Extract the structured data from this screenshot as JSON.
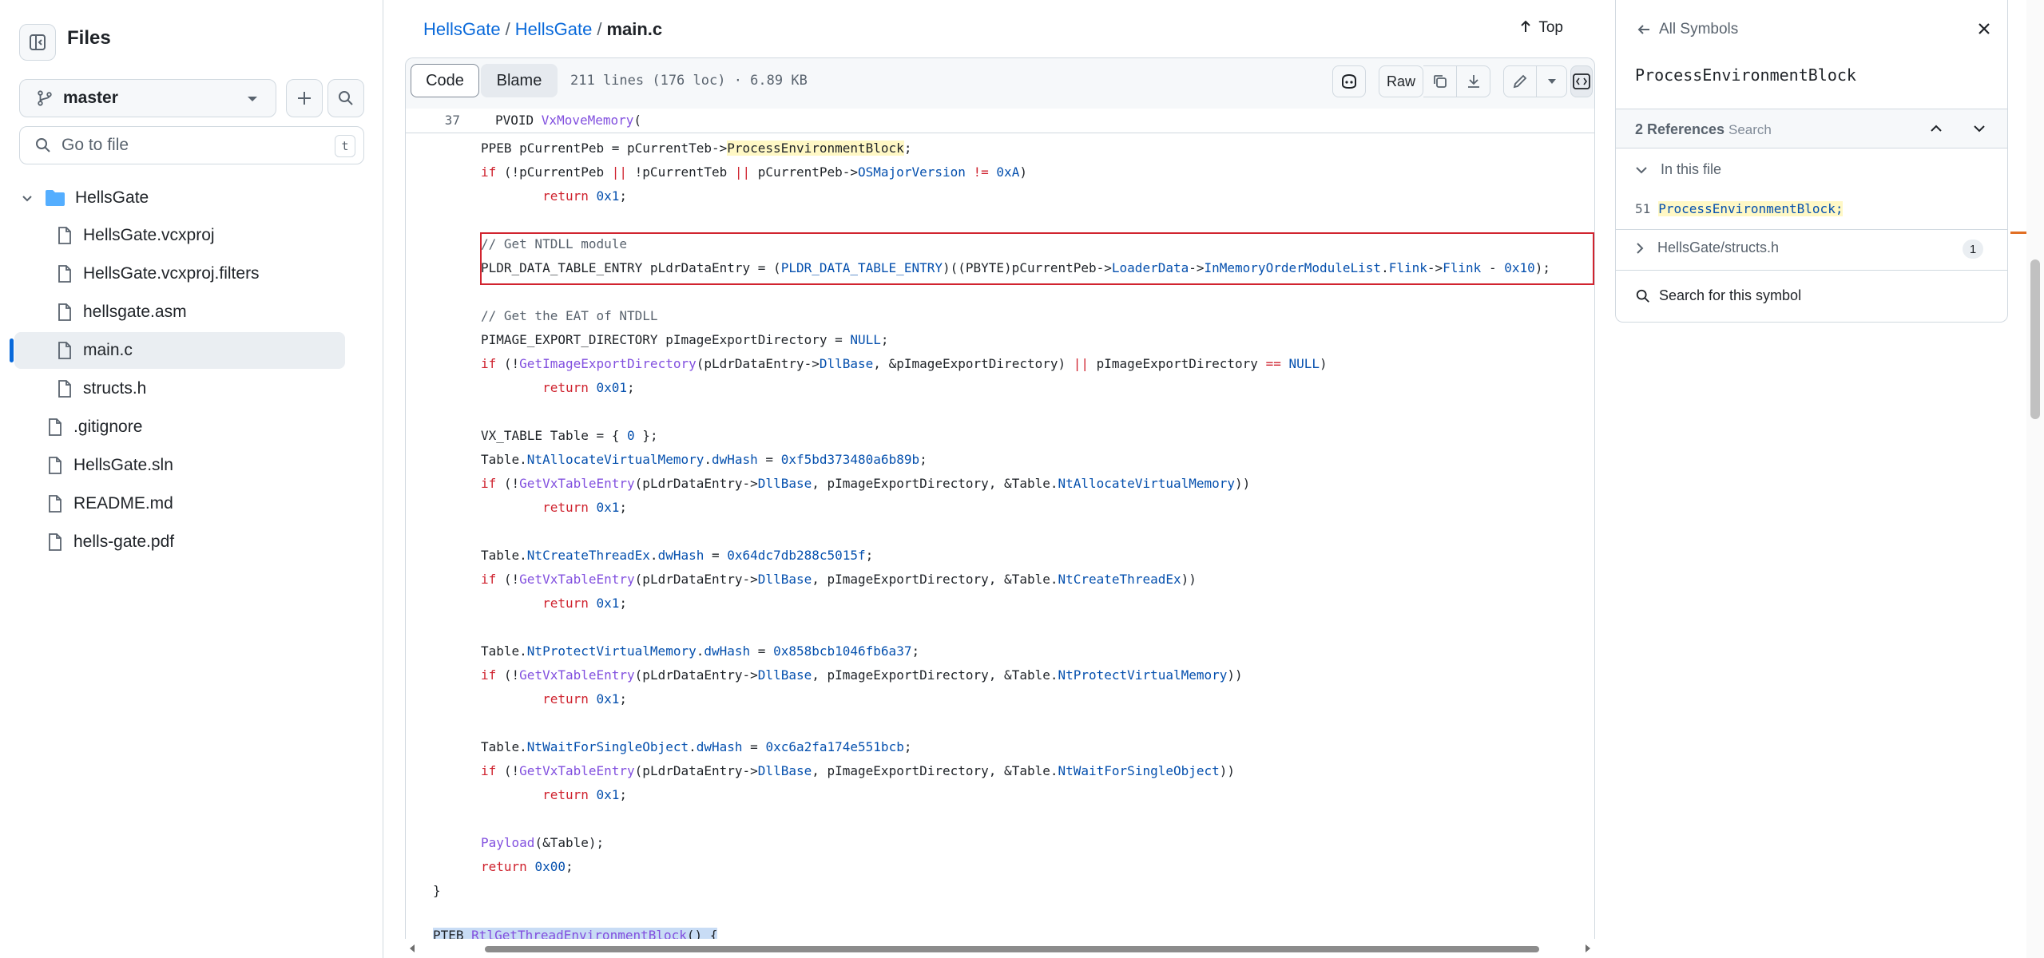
{
  "sidebar": {
    "title": "Files",
    "branch": "master",
    "search_placeholder": "Go to file",
    "search_shortcut": "t",
    "tree": [
      {
        "label": "HellsGate",
        "type": "folder"
      },
      {
        "label": "HellsGate.vcxproj",
        "type": "file"
      },
      {
        "label": "HellsGate.vcxproj.filters",
        "type": "file"
      },
      {
        "label": "hellsgate.asm",
        "type": "file"
      },
      {
        "label": "main.c",
        "type": "file",
        "selected": true
      },
      {
        "label": "structs.h",
        "type": "file"
      },
      {
        "label": ".gitignore",
        "type": "file"
      },
      {
        "label": "HellsGate.sln",
        "type": "file"
      },
      {
        "label": "README.md",
        "type": "file"
      },
      {
        "label": "hells-gate.pdf",
        "type": "file"
      }
    ]
  },
  "header": {
    "crumb_repo": "HellsGate",
    "crumb_dir": "HellsGate",
    "sep": "/",
    "crumb_file": "main.c",
    "top_label": "Top"
  },
  "toolbar": {
    "code_tab": "Code",
    "blame_tab": "Blame",
    "file_info": "211 lines (176 loc) · 6.89 KB",
    "raw_label": "Raw"
  },
  "code": {
    "sticky_line_number": "37",
    "sticky_text": "PVOID ",
    "sticky_fn": "VxMoveMemory",
    "sticky_tail": "("
  },
  "symbols": {
    "back_label": "All Symbols",
    "symbol": "ProcessEnvironmentBlock",
    "refs_label": "2 References",
    "search_placeholder": "Search",
    "in_this_file": "In this file",
    "ref_line": "51",
    "ref_text": "ProcessEnvironmentBlock;",
    "other_file": "HellsGate/structs.h",
    "other_count": "1",
    "search_symbol": "Search for this symbol"
  }
}
